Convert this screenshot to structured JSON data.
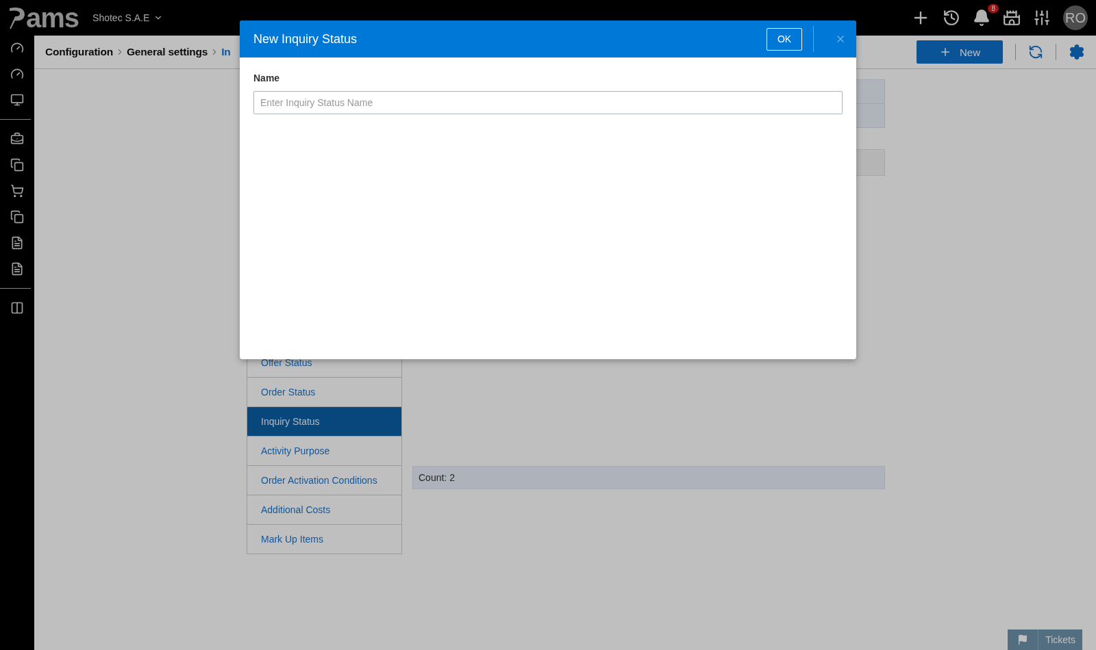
{
  "topbar": {
    "logo_text": "ams",
    "company": "Shotec S.A.E",
    "notifications_badge": "8",
    "avatar": "RO"
  },
  "breadcrumb": [
    {
      "label": "Configuration",
      "current": false
    },
    {
      "label": "General settings",
      "current": false
    },
    {
      "label": "In",
      "current": true
    }
  ],
  "toolbar": {
    "new_button": "New"
  },
  "settings_menu": [
    {
      "label": "Offer Status",
      "selected": false
    },
    {
      "label": "Order Status",
      "selected": false
    },
    {
      "label": "Inquiry Status",
      "selected": true
    },
    {
      "label": "Activity Purpose",
      "selected": false
    },
    {
      "label": "Order Activation Conditions",
      "selected": false
    },
    {
      "label": "Additional Costs",
      "selected": false
    },
    {
      "label": "Mark Up Items",
      "selected": false
    }
  ],
  "count": "Count: 2",
  "dialog": {
    "title": "New Inquiry Status",
    "ok_button": "OK",
    "field_label": "Name",
    "placeholder": "Enter Inquiry Status Name"
  },
  "tickets_button": "Tickets"
}
